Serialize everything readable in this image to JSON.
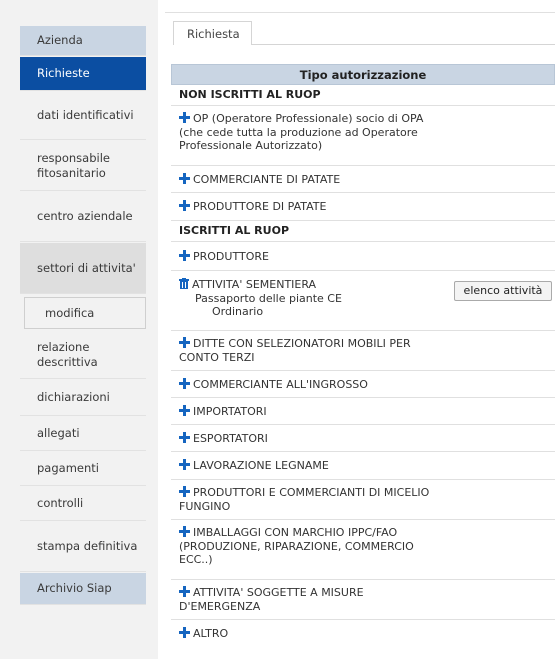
{
  "sidebar": {
    "items": [
      {
        "label": "Azienda"
      },
      {
        "label": "Richieste"
      },
      {
        "label": "dati identificativi"
      },
      {
        "label": "responsabile fitosanitario"
      },
      {
        "label": "centro aziendale"
      },
      {
        "label": "settori di attivita'"
      },
      {
        "label": "modifica"
      },
      {
        "label": "relazione descrittiva"
      },
      {
        "label": "dichiarazioni"
      },
      {
        "label": "allegati"
      },
      {
        "label": "pagamenti"
      },
      {
        "label": "controlli"
      },
      {
        "label": "stampa definitiva"
      },
      {
        "label": "Archivio Siap"
      }
    ]
  },
  "tabs": [
    {
      "label": "Richiesta"
    }
  ],
  "table": {
    "header": "Tipo autorizzazione",
    "rows": [
      {
        "text": "NON ISCRITTI AL RUOP",
        "icon": "none"
      },
      {
        "text": "OP (Operatore Professionale) socio di OPA (che cede tutta la produzione ad Operatore Professionale Autorizzato)",
        "icon": "plus-icon"
      },
      {
        "text": "COMMERCIANTE DI PATATE",
        "icon": "plus-icon"
      },
      {
        "text": "PRODUTTORE DI PATATE",
        "icon": "plus-icon"
      },
      {
        "text": "ISCRITTI AL RUOP",
        "icon": "none"
      },
      {
        "text": "PRODUTTORE",
        "icon": "plus-icon"
      },
      {
        "text": "ATTIVITA' SEMENTIERA",
        "icon": "trash-icon",
        "detail1": "Passaporto delle piante CE",
        "detail2": "Ordinario",
        "button": "elenco attività"
      },
      {
        "text": "DITTE CON SELEZIONATORI MOBILI PER CONTO TERZI",
        "icon": "plus-icon"
      },
      {
        "text": "COMMERCIANTE ALL'INGROSSO",
        "icon": "plus-icon"
      },
      {
        "text": "IMPORTATORI",
        "icon": "plus-icon"
      },
      {
        "text": "ESPORTATORI",
        "icon": "plus-icon"
      },
      {
        "text": "LAVORAZIONE LEGNAME",
        "icon": "plus-icon"
      },
      {
        "text": "PRODUTTORI E COMMERCIANTI DI MICELIO FUNGINO",
        "icon": "plus-icon"
      },
      {
        "text": "IMBALLAGGI CON MARCHIO IPPC/FAO (PRODUZIONE, RIPARAZIONE, COMMERCIO ECC..)",
        "icon": "plus-icon"
      },
      {
        "text": "ATTIVITA' SOGGETTE A MISURE D'EMERGENZA",
        "icon": "plus-icon"
      },
      {
        "text": "ALTRO",
        "icon": "plus-icon"
      }
    ]
  },
  "colors": {
    "accent": "#0b4ea2",
    "header_bg": "#c9d5e3",
    "icon_blue": "#1565c0"
  }
}
